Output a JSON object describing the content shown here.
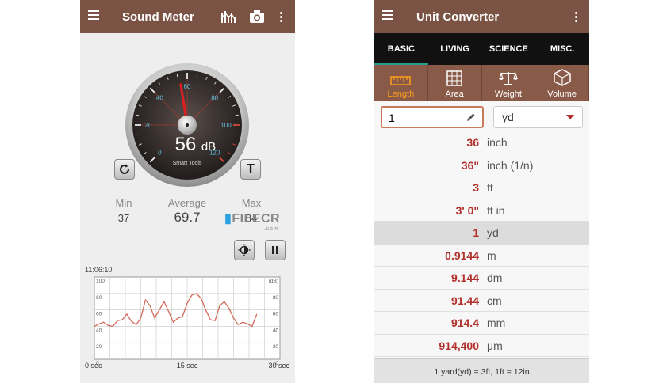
{
  "sound_meter": {
    "title": "Sound Meter",
    "gauge_value": "56",
    "gauge_unit": "dB",
    "gauge_brand": "Smart Tools",
    "gauge_ticks": [
      "0",
      "20",
      "40",
      "60",
      "80",
      "100",
      "120"
    ],
    "needle_db": 56,
    "reset_label": "↻",
    "t_label": "T",
    "stats": {
      "min_label": "Min",
      "min_value": "37",
      "avg_label": "Average",
      "avg_value": "69.7",
      "max_label": "Max",
      "max_value": "84"
    },
    "chart_time": "11:06:10"
  },
  "chart_data": {
    "type": "line",
    "x": [
      0,
      0.75,
      1.5,
      2.25,
      3,
      3.75,
      4.5,
      5.25,
      6,
      6.75,
      7.5,
      8.25,
      9,
      9.75,
      10.5,
      11.25,
      12,
      12.75,
      13.5,
      14.25,
      15,
      15.75,
      16.5,
      17.25,
      18,
      18.75,
      19.5,
      20.25,
      21,
      21.75,
      22.5,
      23.25,
      24,
      24.75,
      25.5,
      26.25
    ],
    "series": [
      {
        "values": [
          40,
          43,
          45,
          41,
          40,
          47,
          48,
          55,
          46,
          42,
          50,
          72,
          65,
          50,
          60,
          70,
          58,
          45,
          50,
          52,
          68,
          78,
          80,
          74,
          60,
          48,
          47,
          65,
          70,
          62,
          50,
          42,
          45,
          43,
          40,
          55
        ]
      }
    ],
    "ylim": [
      0,
      100
    ],
    "xlim": [
      0,
      30
    ],
    "y_ticks_left": [
      "100",
      "80",
      "60",
      "40",
      "20",
      "0"
    ],
    "y_ticks_right": [
      "(dB)",
      "80",
      "60",
      "40",
      "20",
      "0"
    ],
    "x_ticks": [
      "0 sec",
      "15 sec",
      "30 sec"
    ],
    "grid": true
  },
  "unit_converter": {
    "title": "Unit Converter",
    "tabs": [
      "BASIC",
      "LIVING",
      "SCIENCE",
      "MISC."
    ],
    "categories": [
      "Length",
      "Area",
      "Weight",
      "Volume"
    ],
    "input_value": "1",
    "selected_unit": "yd",
    "rows": [
      {
        "value": "36",
        "unit": "inch"
      },
      {
        "value": "36\"",
        "unit": "inch (1/n)"
      },
      {
        "value": "3",
        "unit": "ft"
      },
      {
        "value": "3' 0\"",
        "unit": "ft in"
      },
      {
        "value": "1",
        "unit": "yd"
      },
      {
        "value": "0.9144",
        "unit": "m"
      },
      {
        "value": "9.144",
        "unit": "dm"
      },
      {
        "value": "91.44",
        "unit": "cm"
      },
      {
        "value": "914.4",
        "unit": "mm"
      },
      {
        "value": "914,400",
        "unit": "μm"
      }
    ],
    "footer": "1 yard(yd) = 3ft, 1ft = 12in"
  },
  "watermark": {
    "text": "FILECR",
    "sub": ".com"
  }
}
